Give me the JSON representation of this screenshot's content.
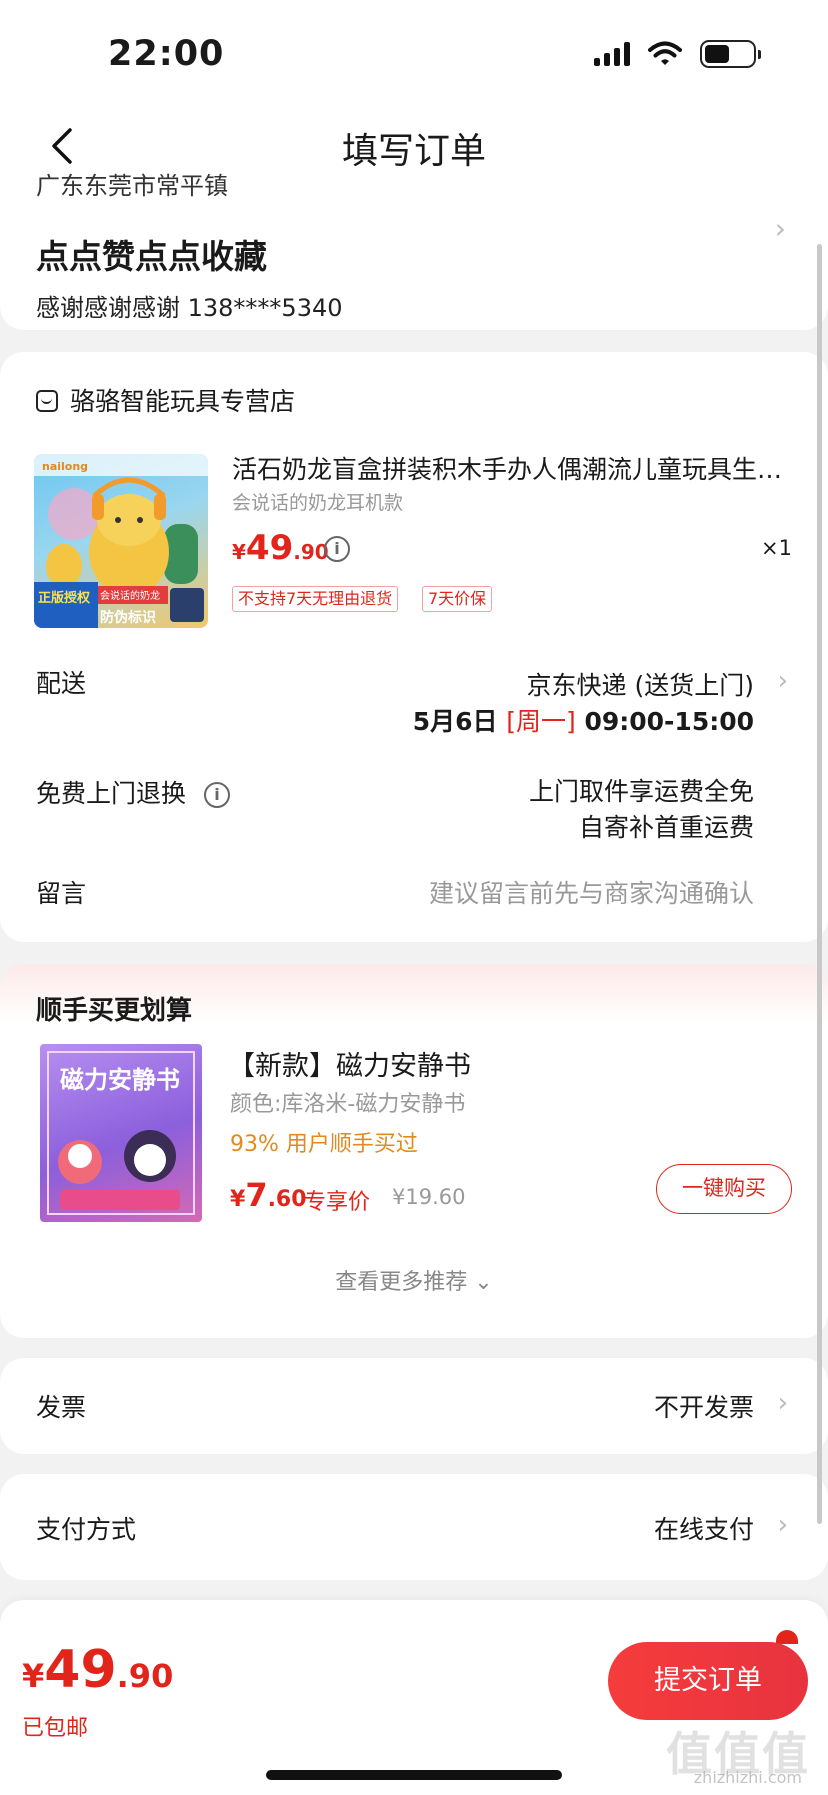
{
  "status_bar": {
    "time": "22:00"
  },
  "nav": {
    "title": "填写订单"
  },
  "address": {
    "region": "广东东莞市常平镇",
    "name": "点点赞点点收藏",
    "contact": "感谢感谢感谢  138****5340"
  },
  "store": {
    "name": "骆骆智能玩具专营店"
  },
  "product": {
    "title": "活石奶龙盲盒拼装积木手办人偶潮流儿童玩具生…",
    "spec": "会说话的奶龙耳机款",
    "price_currency": "¥",
    "price_int": "49",
    "price_dec": ".90",
    "quantity": "×1",
    "tags": [
      "不支持7天无理由退货",
      "7天价保"
    ],
    "img_brand": "nailong",
    "img_badge1": "正版授权",
    "img_badge2": "防伪标识",
    "img_caption": "会说话的奶龙"
  },
  "delivery": {
    "label": "配送",
    "method": "京东快递 (送货上门)",
    "date": "5月6日",
    "weekday": "[周一]",
    "time": "09:00-15:00"
  },
  "return_service": {
    "label": "免费上门退换",
    "line1": "上门取件享运费全免",
    "line2": "自寄补首重运费"
  },
  "message": {
    "label": "留言",
    "placeholder": "建议留言前先与商家沟通确认"
  },
  "recommend": {
    "title": "顺手买更划算",
    "name": "【新款】磁力安静书",
    "color": "颜色:库洛米-磁力安静书",
    "bought": "93% 用户顺手买过",
    "price_currency": "¥",
    "price_int": "7",
    "price_dec": ".60",
    "exclusive_label": "专享价",
    "original_price": "¥19.60",
    "buy_label": "一键购买",
    "more_label": "查看更多推荐 ⌄",
    "img_title": "磁力安静书"
  },
  "invoice": {
    "label": "发票",
    "value": "不开发票"
  },
  "payment": {
    "label": "支付方式",
    "value": "在线支付"
  },
  "footer": {
    "total_currency": "¥",
    "total_int": "49",
    "total_dec": ".90",
    "shipping": "已包邮",
    "submit_label": "提交订单",
    "watermark": "值值值",
    "watermark_sub": "zhizhizhi.com"
  },
  "colors": {
    "accent": "#e1251b",
    "bought": "#e28a1f"
  }
}
